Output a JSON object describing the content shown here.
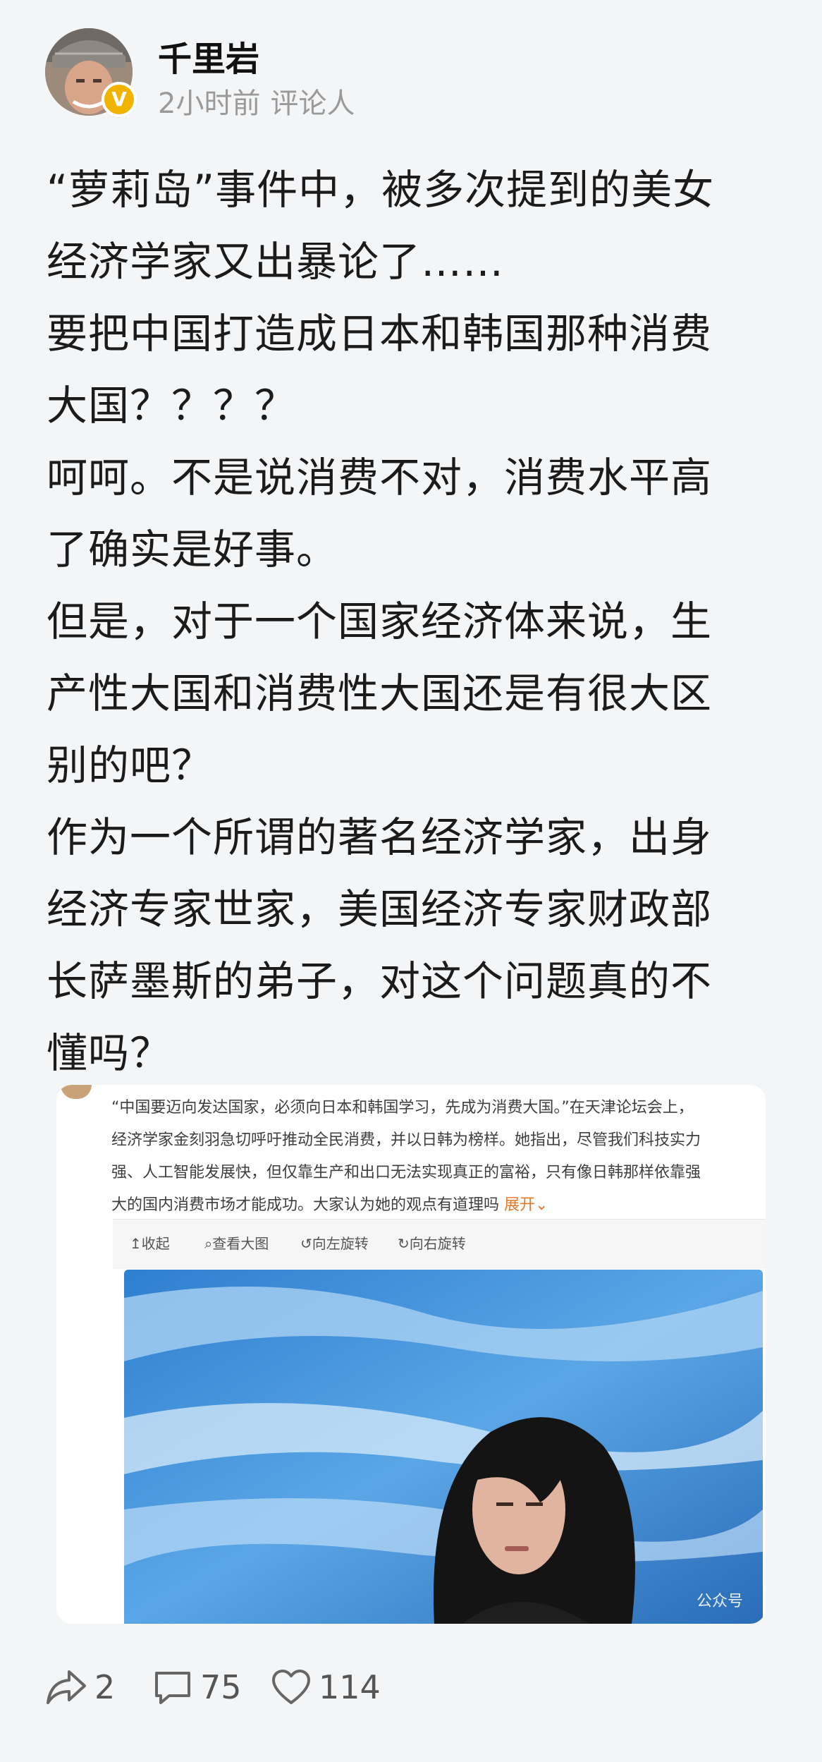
{
  "post": {
    "username": "千里岩",
    "time": "2小时前",
    "role": "评论人",
    "lines": [
      "“萝莉岛”事件中，被多次提到的美女",
      "经济学家又出暴论了……",
      "要把中国打造成日本和韩国那种消费",
      "大国？？？？",
      "呵呵。不是说消费不对，消费水平高",
      "了确实是好事。",
      "但是，对于一个国家经济体来说，生",
      "产性大国和消费性大国还是有很大区",
      "别的吧？",
      "作为一个所谓的著名经济学家，出身",
      "经济专家世家，美国经济专家财政部",
      "长萨墨斯的弟子，对这个问题真的不",
      "懂吗？"
    ]
  },
  "embed": {
    "caption_lines": [
      "“中国要迈向发达国家，必须向日本和韩国学习，先成为消费大国。”在天津论坛会上，",
      "经济学家金刻羽急切呼吁推动全民消费，并以日韩为榜样。她指出，尽管我们科技实力",
      "强、人工智能发展快，但仅靠生产和出口无法实现真正的富裕，只有像日韩那样依靠强",
      "大的国内消费市场才能成功。大家认为她的观点有道理吗"
    ],
    "expand_label": "展开",
    "toolbar": {
      "collapse": "收起",
      "view_large": "查看大图",
      "rotate_left": "向左旋转",
      "rotate_right": "向右旋转"
    },
    "watermark": "公众号"
  },
  "actions": {
    "share_count": "2",
    "comment_count": "75",
    "like_count": "114"
  },
  "colors": {
    "background": "#f4f5f7",
    "badge": "#f0b400",
    "expand": "#e07a2f"
  }
}
